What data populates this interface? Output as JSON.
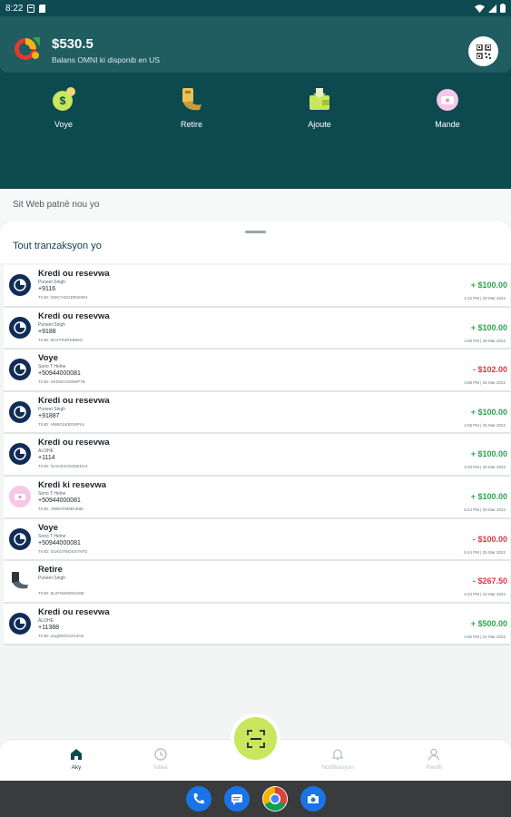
{
  "status_bar": {
    "time": "8:22"
  },
  "header": {
    "balance": "$530.5",
    "balance_caption": "Balans OMNI ki disponib en US"
  },
  "actions": [
    {
      "label": "Voye",
      "icon": "send-money-icon"
    },
    {
      "label": "Retire",
      "icon": "withdraw-icon"
    },
    {
      "label": "Ajoute",
      "icon": "wallet-add-icon"
    },
    {
      "label": "Mande",
      "icon": "request-money-icon"
    }
  ],
  "partner_sites": {
    "label": "Sit Web patnè nou yo"
  },
  "transactions_sheet": {
    "title": "Tout tranzaksyon yo"
  },
  "transactions": [
    {
      "title": "Kredi ou resevwa",
      "name": "Puneet Singh",
      "phone": "+9116",
      "txid": "TrnID: W2K7ADGDRSMR4",
      "amount": "+ $100.00",
      "date": "4:12 PM | 29 Mar 2022",
      "type": "pos",
      "avatar": "dark"
    },
    {
      "title": "Kredi ou resevwa",
      "name": "Puneet Singh",
      "phone": "+9188",
      "txid": "TrnID: 8GVYR4RKB6M1",
      "amount": "+ $100.00",
      "date": "4:08 PM | 29 Mar 2022",
      "type": "pos",
      "avatar": "dark"
    },
    {
      "title": "Voye",
      "name": "Sono T Helne",
      "phone": "+50944000081",
      "txid": "TrnID: SKDW1GD8WP7B",
      "amount": "- $102.00",
      "date": "4:58 PM | 25 Mar 2022",
      "type": "neg",
      "avatar": "dark"
    },
    {
      "title": "Kredi ou resevwa",
      "name": "Puneet Singh",
      "phone": "+91887",
      "txid": "TrnID: HM6GSKBGMPLK",
      "amount": "+ $100.00",
      "date": "4:08 PM | 25 Mar 2022",
      "type": "pos",
      "avatar": "dark"
    },
    {
      "title": "Kredi ou resevwa",
      "name": "ALOHE",
      "phone": "+1114",
      "txid": "TrnID: GmmD1HG6DKDV4",
      "amount": "+ $100.00",
      "date": "3:33 PM | 25 Mar 2022",
      "type": "pos",
      "avatar": "dark"
    },
    {
      "title": "Kredi ki resevwa",
      "name": "Sono T Helne",
      "phone": "+50944000081",
      "txid": "TrnID: JWBGF8MBAE8E",
      "amount": "+ $100.00",
      "date": "5:44 PM | 25 Mar 2022",
      "type": "pos",
      "avatar": "pink"
    },
    {
      "title": "Voye",
      "name": "Sono T Helne",
      "phone": "+50944000081",
      "txid": "TrnID: GUKD7WDSSTKFD",
      "amount": "- $100.00",
      "date": "5:44 PM | 25 Mar 2022",
      "type": "neg",
      "avatar": "dark"
    },
    {
      "title": "Retire",
      "name": "Puneet Singh",
      "phone": "",
      "txid": "TrnID: 8L0FNW6RWA8M",
      "amount": "- $267.50",
      "date": "4:43 PM | 23 Mar 2022",
      "type": "neg",
      "avatar": "plain"
    },
    {
      "title": "Kredi ou resevwa",
      "name": "ALOHE",
      "phone": "+11388",
      "txid": "TrnID: wxgbN8XS2G3HK",
      "amount": "+ $500.00",
      "date": "4:56 PM | 22 Mar 2022",
      "type": "pos",
      "avatar": "dark"
    }
  ],
  "bottom_nav": [
    {
      "label": "Aky",
      "icon": "home-icon",
      "active": true
    },
    {
      "label": "Istwa",
      "icon": "history-icon",
      "active": false
    },
    {
      "label": "Notifikasyon",
      "icon": "bell-icon",
      "active": false
    },
    {
      "label": "Pwofil",
      "icon": "profile-icon",
      "active": false
    }
  ],
  "dock": [
    "phone-icon",
    "messages-icon",
    "chrome-icon",
    "camera-icon"
  ],
  "colors": {
    "header": "#0c4a4f",
    "accent": "#c8e75c",
    "positive": "#2ea44f",
    "negative": "#e0383d"
  }
}
